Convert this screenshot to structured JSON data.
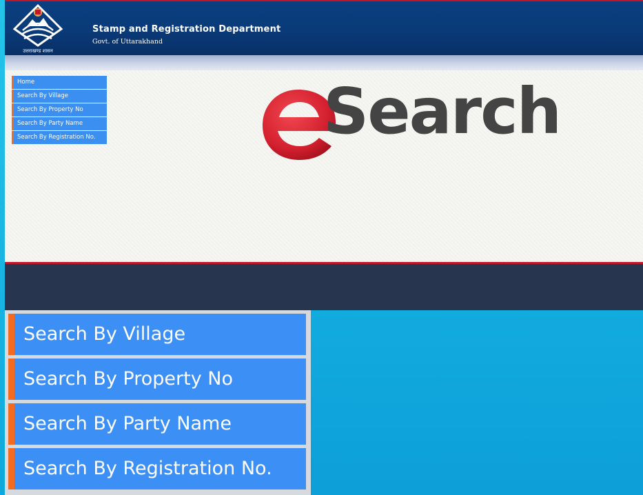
{
  "header": {
    "title": "Stamp and Registration Department",
    "subtitle": "Govt. of Uttarakhand",
    "emblem_caption": "उत्तराखण्ड शासन",
    "emblem_icon": "uttarakhand-emblem-icon"
  },
  "side_menu": {
    "items": [
      {
        "label": "Home"
      },
      {
        "label": "Search By Village"
      },
      {
        "label": "Search By Property No"
      },
      {
        "label": "Search By Party Name"
      },
      {
        "label": "Search By Registration No."
      }
    ]
  },
  "logo": {
    "text": "Search",
    "icon": "esearch-e-icon"
  },
  "big_menu": {
    "items": [
      {
        "label": "Search By Village"
      },
      {
        "label": "Search By Property No"
      },
      {
        "label": "Search By Party Name"
      },
      {
        "label": "Search By Registration No."
      }
    ]
  },
  "colors": {
    "header_bg": "#0a3a78",
    "menu_blue": "#3b8ff0",
    "menu_accent": "#f26b21",
    "logo_red": "#d4202f",
    "logo_text": "#444444",
    "dark_band": "#27354f"
  }
}
